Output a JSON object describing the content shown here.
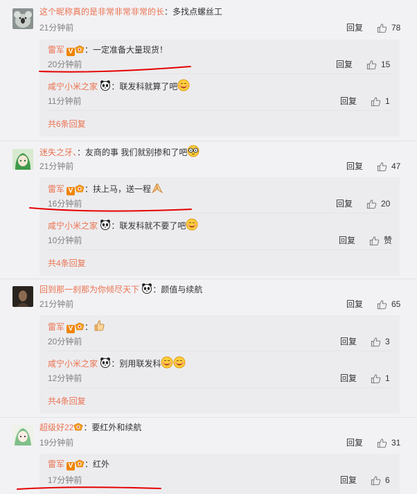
{
  "colors": {
    "username": "#eb7350",
    "annotation": "#e60000",
    "vip_badge": "#f08400"
  },
  "common": {
    "reply_label": "回复",
    "like_icon": "thumbs-up-icon"
  },
  "comments": [
    {
      "user": "这个昵称真的是非常非常非常的长",
      "text": "：多找点螺丝工",
      "time": "21分钟前",
      "likes": "78",
      "replies": [
        {
          "user": "雷军",
          "text": "：一定准备大量现货！",
          "time": "20分钟前",
          "likes": "15"
        },
        {
          "user": "咸宁小米之家",
          "text": "：联发科就算了吧",
          "time": "11分钟前",
          "likes": "1"
        }
      ],
      "more": "共6条回复"
    },
    {
      "user": "迷失之牙、",
      "text": "：友商的事 我们就别掺和了吧",
      "time": "21分钟前",
      "likes": "47",
      "replies": [
        {
          "user": "雷军",
          "text": "：扶上马，送一程",
          "time": "16分钟前",
          "likes": "20"
        },
        {
          "user": "咸宁小米之家",
          "text": "：联发科就不要了吧",
          "time": "10分钟前",
          "likes": "赞"
        }
      ],
      "more": "共4条回复"
    },
    {
      "user": "回到那一刹那为你倾尽天下",
      "text": "：颜值与续航",
      "time": "21分钟前",
      "likes": "65",
      "replies": [
        {
          "user": "雷军",
          "text": "：",
          "time": "20分钟前",
          "likes": "3"
        },
        {
          "user": "咸宁小米之家",
          "text": "：别用联发科",
          "time": "12分钟前",
          "likes": "1"
        }
      ],
      "more": "共4条回复"
    },
    {
      "user": "超级好22",
      "text": "：要红外和续航",
      "time": "19分钟前",
      "likes": "31",
      "replies": [
        {
          "user": "雷军",
          "text": "：红外",
          "time": "17分钟前",
          "likes": "6"
        }
      ]
    }
  ]
}
